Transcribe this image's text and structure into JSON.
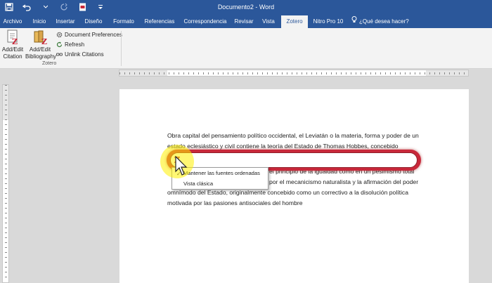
{
  "window": {
    "title": "Documento2 - Word"
  },
  "quick_access": {
    "icons": [
      "save-icon",
      "undo-icon",
      "redo-icon",
      "pdf-icon",
      "customize-icon"
    ]
  },
  "tabs": [
    {
      "label": "Archivo"
    },
    {
      "label": "Inicio"
    },
    {
      "label": "Insertar"
    },
    {
      "label": "Diseño"
    },
    {
      "label": "Formato"
    },
    {
      "label": "Referencias"
    },
    {
      "label": "Correspondencia"
    },
    {
      "label": "Revisar"
    },
    {
      "label": "Vista"
    },
    {
      "label": "Zotero"
    },
    {
      "label": "Nitro Pro 10"
    }
  ],
  "tell_me": "¿Qué desea hacer?",
  "ribbon": {
    "add_edit_citation": [
      "Add/Edit",
      "Citation"
    ],
    "add_edit_bibliography": [
      "Add/Edit",
      "Bibliography"
    ],
    "document_preferences": "Document Preferences",
    "refresh": "Refresh",
    "unlink_citations": "Unlink Citations",
    "group_label": "Zotero"
  },
  "document": {
    "paragraph1": "Obra capital del pensamiento político occidental, el Leviatán o la materia, forma y poder de un estado eclesiástico y civil contiene la teoría del Estado de Thomas Hobbes, concebido",
    "paragraph2_line1": "el principio de la igualdad como en un pesimismo total",
    "paragraph2_line2": "por el mecanicismo naturalista y la afirmación del poder",
    "paragraph2_line3": "omnímodo del Estado, originalmente concebido como un correctivo a la disolución política",
    "paragraph2_line4": "motivada por las pasiones antisociales del hombre"
  },
  "quick_format": {
    "menu_items": [
      "Mantener las fuentes ordenadas",
      "Vista clásica"
    ]
  },
  "colors": {
    "word_blue": "#2b579a",
    "zotero_red": "#c8283a",
    "highlight": "#fff000"
  }
}
